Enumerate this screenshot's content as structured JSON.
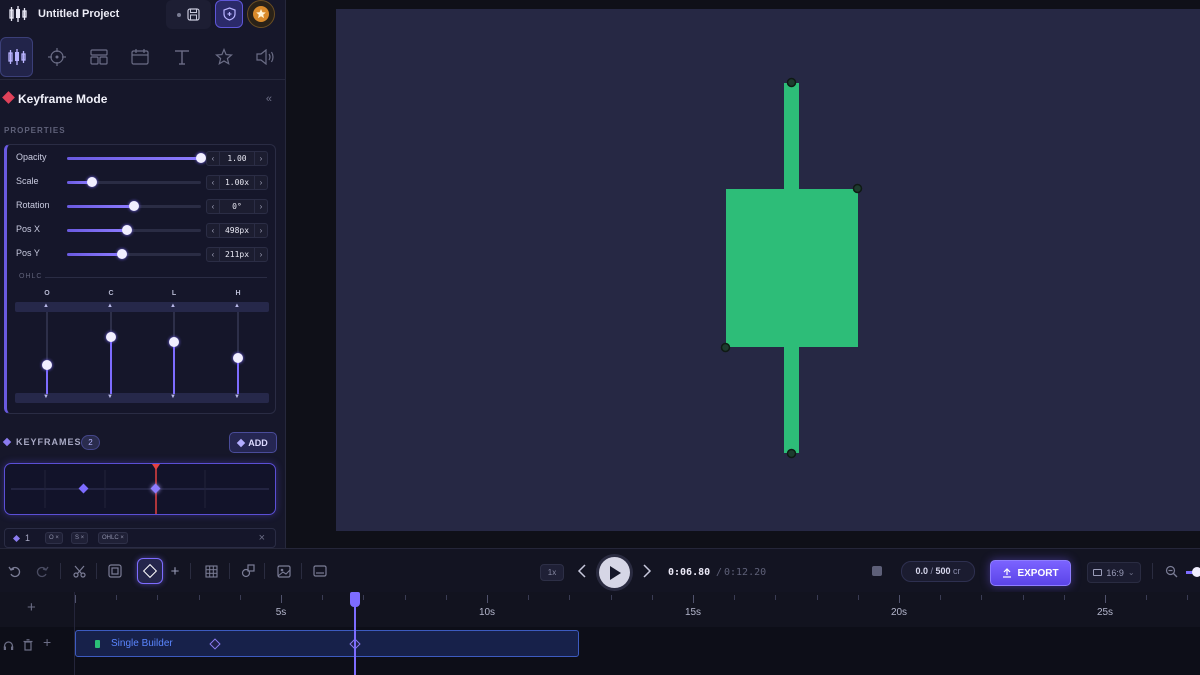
{
  "app": {
    "project_title": "Untitled Project"
  },
  "panel": {
    "mode_title": "Keyframe Mode",
    "properties_label": "PROPERTIES",
    "properties": [
      {
        "label": "Opacity",
        "value": "1.00",
        "level": 1.0
      },
      {
        "label": "Scale",
        "value": "1.00x",
        "level": 0.19
      },
      {
        "label": "Rotation",
        "value": "0°",
        "level": 0.5
      },
      {
        "label": "Pos X",
        "value": "498px",
        "level": 0.45
      },
      {
        "label": "Pos Y",
        "value": "211px",
        "level": 0.41
      }
    ],
    "ohlc_label": "OHLC",
    "ohlc": [
      {
        "label": "O",
        "level": 0.35
      },
      {
        "label": "C",
        "level": 0.7
      },
      {
        "label": "L",
        "level": 0.64
      },
      {
        "label": "H",
        "level": 0.44
      }
    ],
    "keyframes_title": "KEYFRAMES",
    "keyframes_count": "2",
    "add_label": "ADD",
    "keyframe_item": {
      "index": "1",
      "chips": [
        "O ×",
        "S ×",
        "OHLC ×"
      ],
      "close": "×"
    }
  },
  "toolbar": {
    "speed": "1x",
    "time_current": "0:06.80",
    "time_separator": "/",
    "time_total": "0:12.20",
    "credits_used": "0.0",
    "credits_sep": " / ",
    "credits_total": "500",
    "credits_unit": " cr",
    "export_label": "EXPORT",
    "aspect_label": "16:9",
    "aspect_chevron": "⌄"
  },
  "timeline": {
    "tick_labels": [
      "5s",
      "10s",
      "15s",
      "20s",
      "25s"
    ],
    "playhead_seconds": 6.8,
    "clip": {
      "label": "Single Builder",
      "keyframe_seconds": [
        3.4,
        6.8
      ]
    }
  },
  "colors": {
    "accent": "#7d6cff",
    "candle": "#2dbd78",
    "canvas": "#262844",
    "danger": "#e0425a"
  }
}
